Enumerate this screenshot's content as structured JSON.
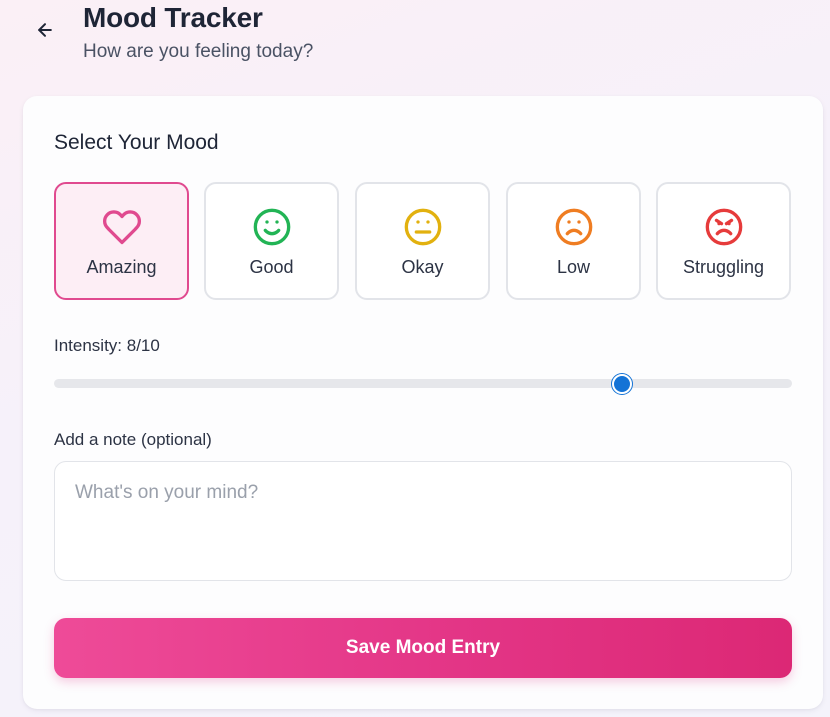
{
  "header": {
    "back_icon": "arrow-left-icon",
    "title": "Mood Tracker",
    "subtitle": "How are you feeling today?"
  },
  "mood_section": {
    "title": "Select Your Mood",
    "selected": "Amazing",
    "options": [
      {
        "label": "Amazing",
        "icon": "heart-icon",
        "color": "#e04a8f"
      },
      {
        "label": "Good",
        "icon": "smile-icon",
        "color": "#22b455"
      },
      {
        "label": "Okay",
        "icon": "neutral-face-icon",
        "color": "#e2b10f"
      },
      {
        "label": "Low",
        "icon": "frown-icon",
        "color": "#ef7d22"
      },
      {
        "label": "Struggling",
        "icon": "angry-face-icon",
        "color": "#e63b3b"
      }
    ]
  },
  "intensity": {
    "label": "Intensity: 8/10",
    "value": 8,
    "max": 10,
    "thumb_color": "#1473d6"
  },
  "note": {
    "label": "Add a note (optional)",
    "placeholder": "What's on your mind?",
    "value": ""
  },
  "save_button": {
    "label": "Save Mood Entry",
    "color_start": "#ee4b98",
    "color_end": "#dc2875"
  }
}
